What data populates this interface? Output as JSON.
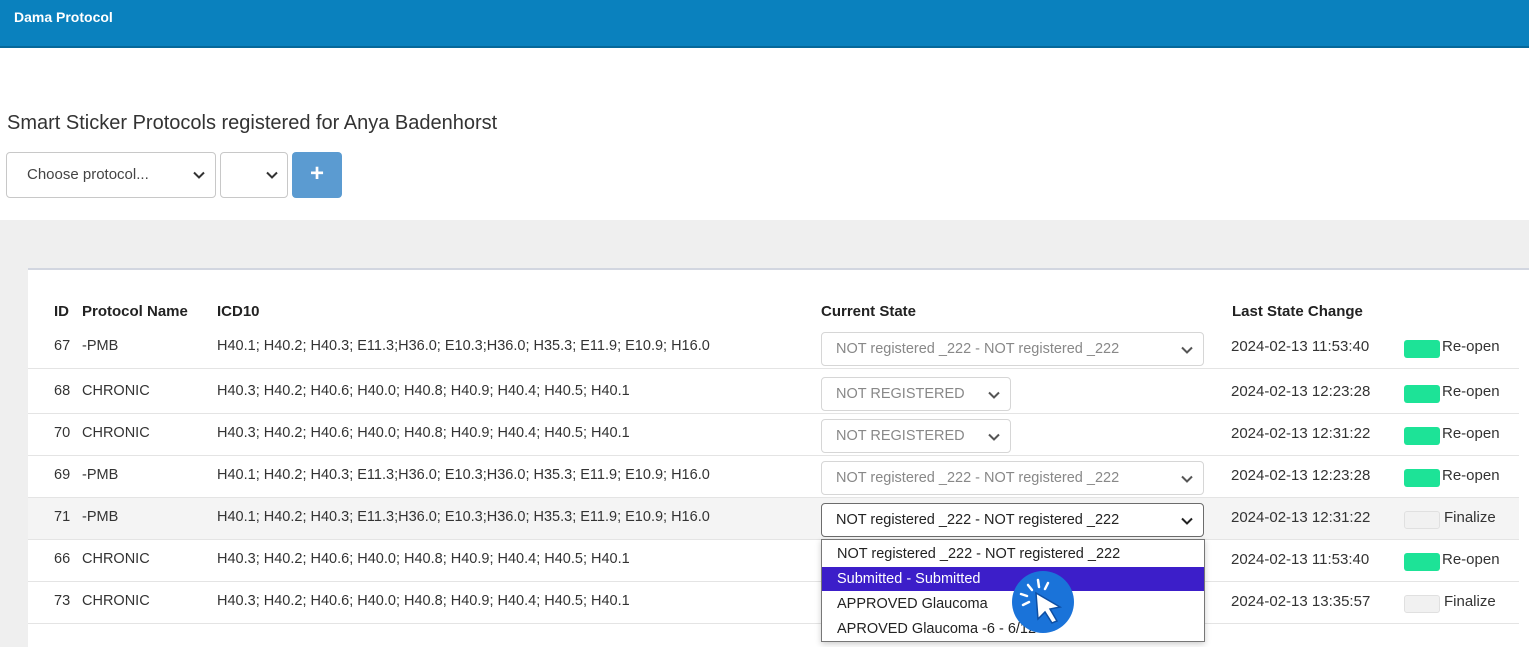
{
  "app": {
    "title": "Dama Protocol"
  },
  "page": {
    "heading": "Smart Sticker Protocols registered for Anya Badenhorst"
  },
  "controls": {
    "protocol_select": {
      "value": "Choose protocol..."
    },
    "secondary_select": {
      "value": ""
    },
    "add_button": {
      "label": "+"
    }
  },
  "table": {
    "headers": {
      "id": "ID",
      "protocol_name": "Protocol Name",
      "icd10": "ICD10",
      "current_state": "Current State",
      "last_state_change": "Last State Change"
    },
    "rows": [
      {
        "id": "67",
        "name": "-PMB",
        "icd10": "H40.1; H40.2; H40.3; E11.3;H36.0; E10.3;H36.0; H35.3; E11.9; E10.9; H16.0",
        "state": "NOT registered _222 - NOT registered _222",
        "last_change": "2024-02-13 11:53:40",
        "action": "Re-open",
        "toggle_on": true
      },
      {
        "id": "68",
        "name": "CHRONIC",
        "icd10": "H40.3; H40.2; H40.6; H40.0; H40.8; H40.9; H40.4; H40.5; H40.1",
        "state": "NOT REGISTERED",
        "last_change": "2024-02-13 12:23:28",
        "action": "Re-open",
        "toggle_on": true
      },
      {
        "id": "70",
        "name": "CHRONIC",
        "icd10": "H40.3; H40.2; H40.6; H40.0; H40.8; H40.9; H40.4; H40.5; H40.1",
        "state": "NOT REGISTERED",
        "last_change": "2024-02-13 12:31:22",
        "action": "Re-open",
        "toggle_on": true
      },
      {
        "id": "69",
        "name": "-PMB",
        "icd10": "H40.1; H40.2; H40.3; E11.3;H36.0; E10.3;H36.0; H35.3; E11.9; E10.9; H16.0",
        "state": "NOT registered _222 - NOT registered _222",
        "last_change": "2024-02-13 12:23:28",
        "action": "Re-open",
        "toggle_on": true
      },
      {
        "id": "71",
        "name": "-PMB",
        "icd10": "H40.1; H40.2; H40.3; E11.3;H36.0; E10.3;H36.0; H35.3; E11.9; E10.9; H16.0",
        "state": "NOT registered _222 - NOT registered _222",
        "last_change": "2024-02-13 12:31:22",
        "action": "Finalize",
        "toggle_on": false
      },
      {
        "id": "66",
        "name": "CHRONIC",
        "icd10": "H40.3; H40.2; H40.6; H40.0; H40.8; H40.9; H40.4; H40.5; H40.1",
        "state": "",
        "last_change": "2024-02-13 11:53:40",
        "action": "Re-open",
        "toggle_on": true
      },
      {
        "id": "73",
        "name": "CHRONIC",
        "icd10": "H40.3; H40.2; H40.6; H40.0; H40.8; H40.9; H40.4; H40.5; H40.1",
        "state": "",
        "last_change": "2024-02-13 13:35:57",
        "action": "Finalize",
        "toggle_on": false
      }
    ]
  },
  "dropdown": {
    "options": [
      "NOT registered _222 - NOT registered _222",
      "Submitted - Submitted",
      "APPROVED Glaucoma",
      "APROVED Glaucoma -6 - 6/12"
    ],
    "highlighted_index": 1
  },
  "colors": {
    "topbar": "#0a81be",
    "toggle_on": "#1de397",
    "add_button": "#5b9bd1",
    "option_highlight": "#3c1ec9",
    "cursor_badge": "#1a73d9"
  },
  "icons": {
    "chevron": "chevron-down-icon",
    "cursor": "click-cursor-icon"
  }
}
